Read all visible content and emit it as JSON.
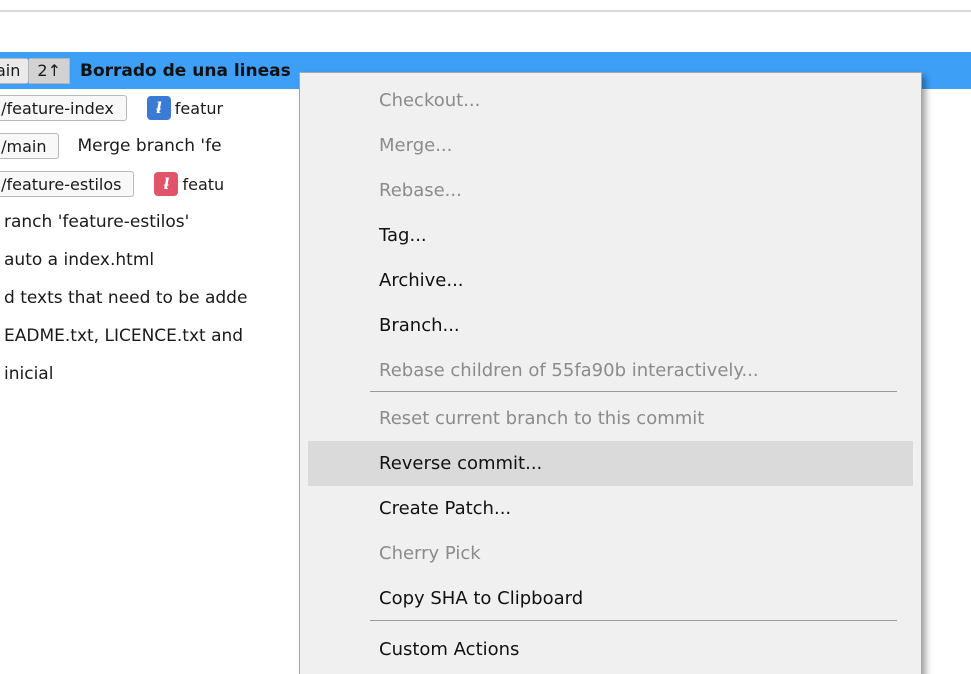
{
  "log": {
    "rows": [
      {
        "tag": "ain",
        "count": "2↑",
        "message": "Borrado de una lineas"
      },
      {
        "tag": "’/feature-index",
        "branch": "featur",
        "branch_color": "#3a7bd5"
      },
      {
        "tag": "’/main",
        "message": "Merge branch 'fe"
      },
      {
        "tag": "’/feature-estilos",
        "branch": "featu",
        "branch_color": "#e0556a"
      },
      {
        "message": "ranch 'feature-estilos'"
      },
      {
        "message": "auto a index.html"
      },
      {
        "message": "d texts that need to be adde"
      },
      {
        "message": "EADME.txt, LICENCE.txt and"
      },
      {
        "message": "inicial"
      }
    ]
  },
  "menu": {
    "items": [
      {
        "label": "Checkout...",
        "enabled": false
      },
      {
        "label": "Merge...",
        "enabled": false
      },
      {
        "label": "Rebase...",
        "enabled": false
      },
      {
        "label": "Tag...",
        "enabled": true
      },
      {
        "label": "Archive...",
        "enabled": true
      },
      {
        "label": "Branch...",
        "enabled": true
      },
      {
        "label": "Rebase children of 55fa90b interactively...",
        "enabled": false
      },
      {
        "label": "Reset current branch to this commit",
        "enabled": false
      },
      {
        "label": "Reverse commit...",
        "enabled": true,
        "highlighted": true
      },
      {
        "label": "Create Patch...",
        "enabled": true
      },
      {
        "label": "Cherry Pick",
        "enabled": false
      },
      {
        "label": "Copy SHA to Clipboard",
        "enabled": true
      },
      {
        "label": "Custom Actions",
        "enabled": true
      }
    ]
  },
  "colors": {
    "selection": "#3d9ff6",
    "menu_bg": "#f0f0f0",
    "menu_hover": "#dadada",
    "disabled_text": "#8b8b8b"
  }
}
